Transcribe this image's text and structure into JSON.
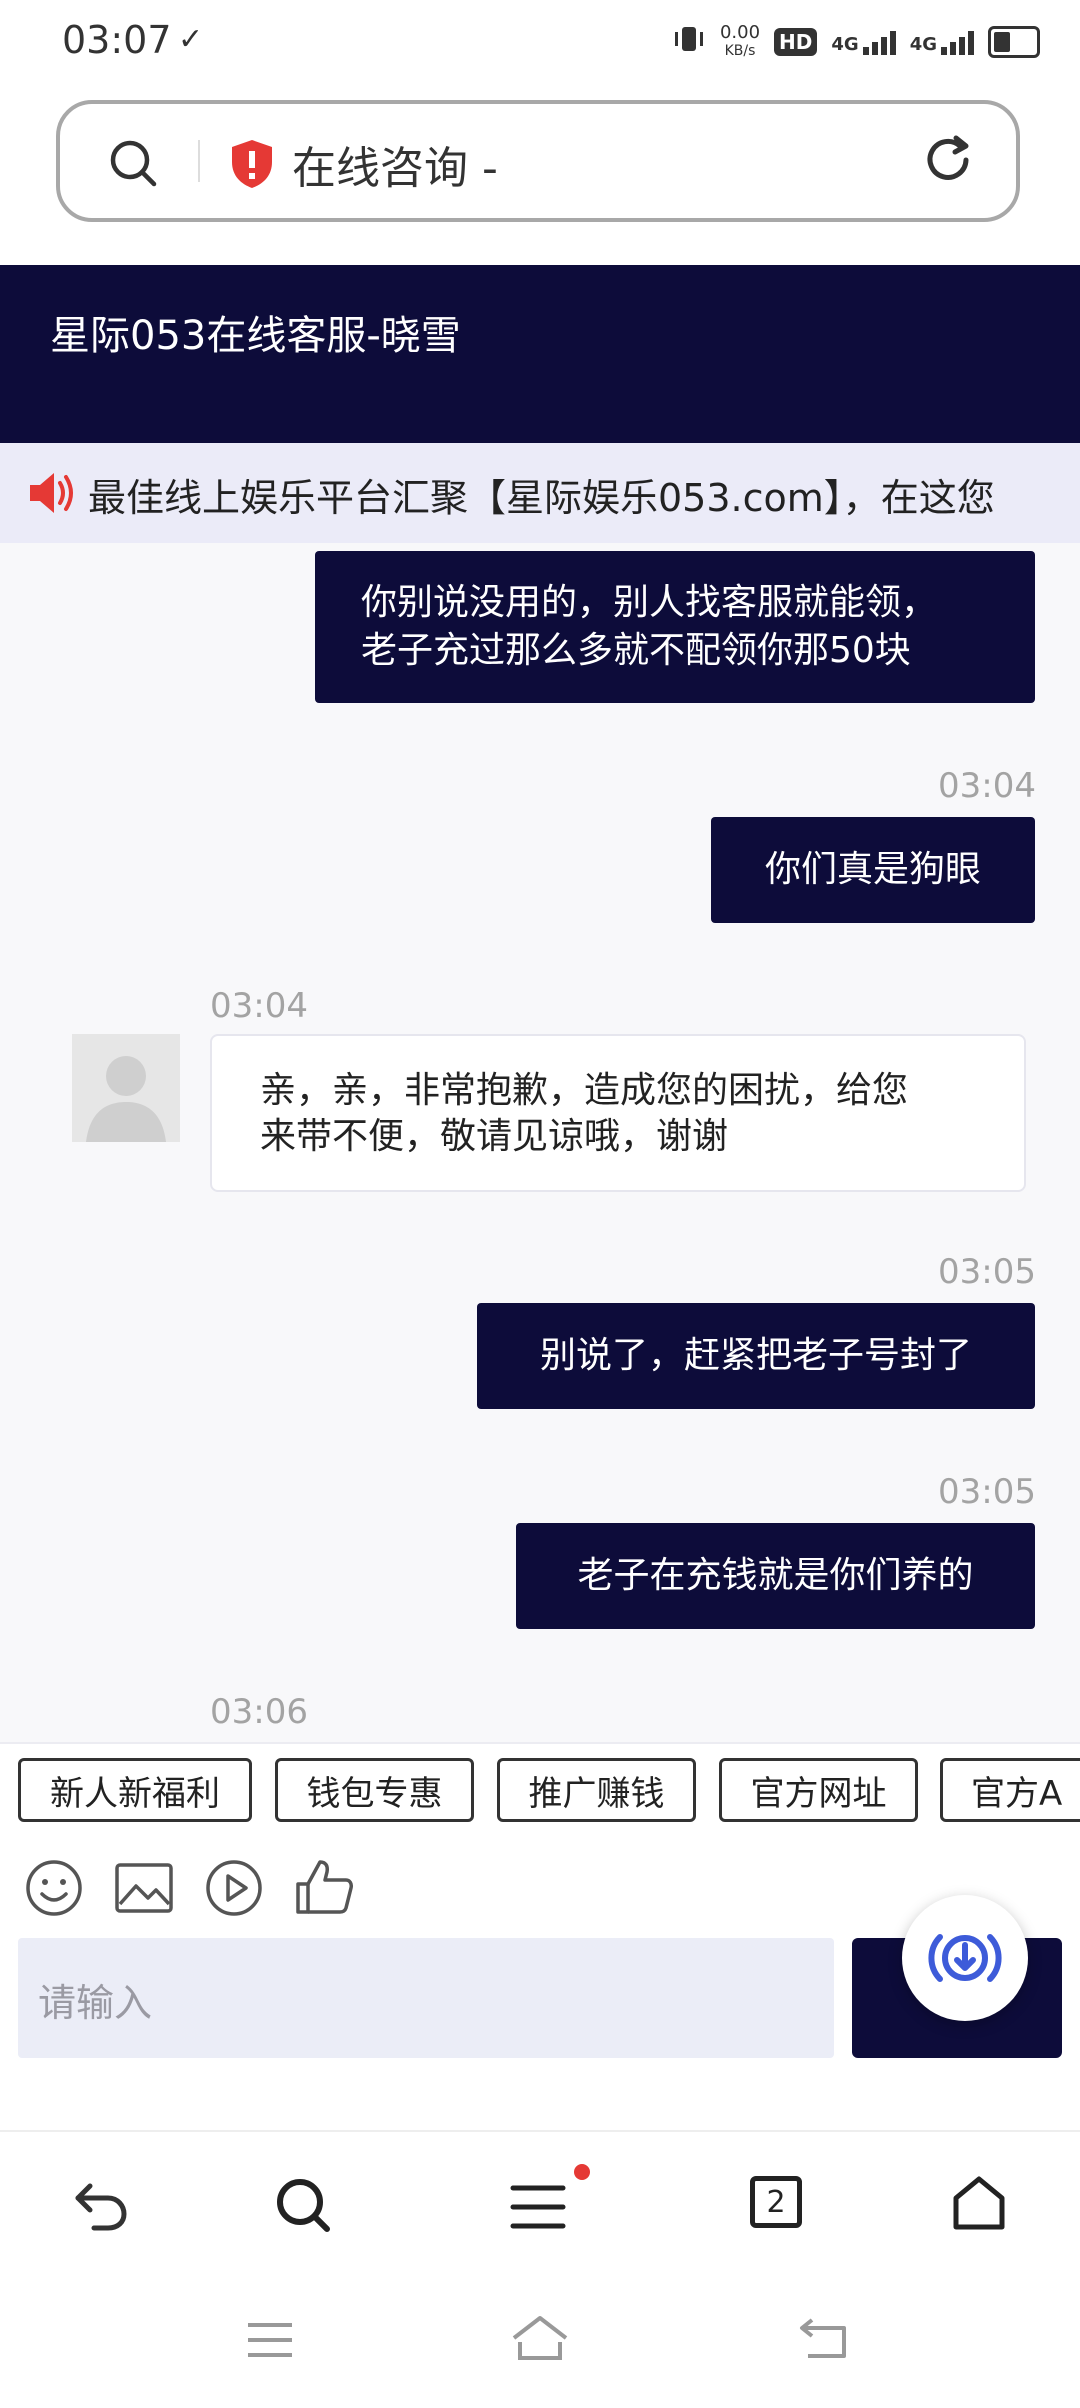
{
  "status_bar": {
    "time": "03:07",
    "net_speed": "0.00",
    "net_unit": "KB/s",
    "hd": "HD",
    "net1": "4G",
    "net2": "4G"
  },
  "url_bar": {
    "title": "在线咨询 -"
  },
  "chat_header": {
    "title": "星际053在线客服-晓雪"
  },
  "announcement": {
    "text": "最佳线上娱乐平台汇聚【星际娱乐053.com】，在这您"
  },
  "messages": [
    {
      "side": "out",
      "text_lines": [
        "你别说没用的，别人找客服就能领，",
        "老子充过那么多就不配领你那50块"
      ]
    },
    {
      "side": "out",
      "time": "03:04",
      "text": "你们真是狗眼"
    },
    {
      "side": "in",
      "time": "03:04",
      "text_lines": [
        "亲，亲，非常抱歉，造成您的困扰，给您",
        "来带不便，敬请见谅哦，谢谢"
      ]
    },
    {
      "side": "out",
      "time": "03:05",
      "text": "别说了，赶紧把老子号封了"
    },
    {
      "side": "out",
      "time": "03:05",
      "text": "老子在充钱就是你们养的"
    },
    {
      "side": "in",
      "time": "03:06"
    }
  ],
  "quick_replies": [
    "新人新福利",
    "钱包专惠",
    "推广赚钱",
    "官方网址",
    "官方A"
  ],
  "input": {
    "placeholder": "请输入"
  },
  "tab_count": "2",
  "colors": {
    "primary": "#0d0c3a",
    "notification_dot": "#e53935",
    "shield": "#e53935",
    "fab_icon": "#3d5bd9"
  }
}
